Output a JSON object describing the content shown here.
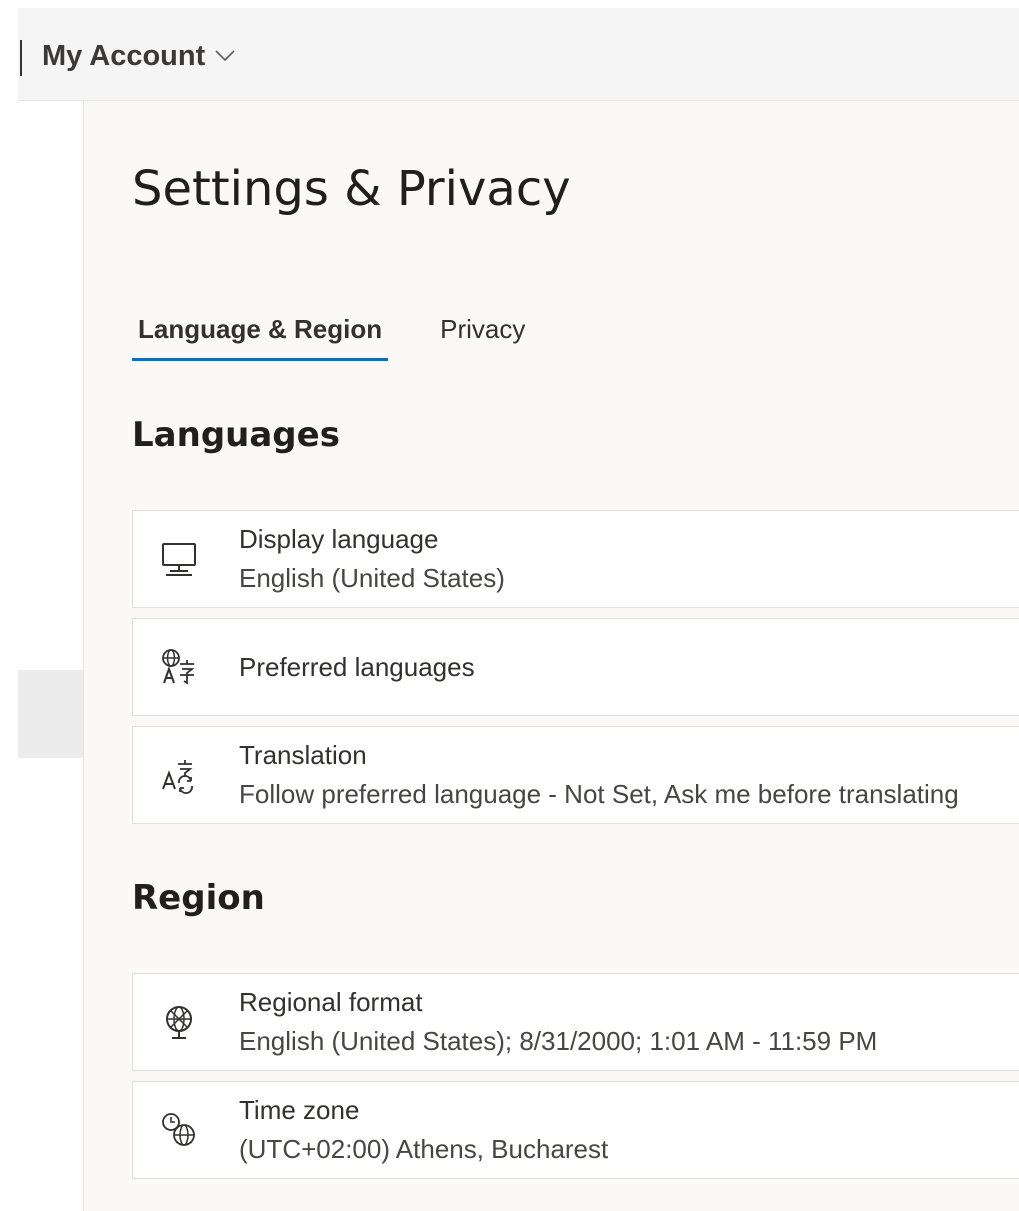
{
  "header": {
    "account_label": "My Account"
  },
  "page": {
    "title": "Settings & Privacy"
  },
  "tabs": [
    {
      "label": "Language & Region",
      "active": true
    },
    {
      "label": "Privacy",
      "active": false
    }
  ],
  "sections": {
    "languages": {
      "title": "Languages",
      "items": [
        {
          "icon": "monitor-icon",
          "title": "Display language",
          "subtitle": "English (United States)"
        },
        {
          "icon": "globe-language-icon",
          "title": "Preferred languages",
          "subtitle": ""
        },
        {
          "icon": "translate-icon",
          "title": "Translation",
          "subtitle": "Follow preferred language - Not Set, Ask me before translating"
        }
      ]
    },
    "region": {
      "title": "Region",
      "items": [
        {
          "icon": "globe-settings-icon",
          "title": "Regional format",
          "subtitle": "English (United States); 8/31/2000; 1:01 AM - 11:59 PM"
        },
        {
          "icon": "clock-globe-icon",
          "title": "Time zone",
          "subtitle": "(UTC+02:00) Athens, Bucharest"
        }
      ]
    }
  },
  "colors": {
    "accent": "#0f6cbd",
    "background": "#faf9f8",
    "topbar": "#f5f5f5"
  }
}
